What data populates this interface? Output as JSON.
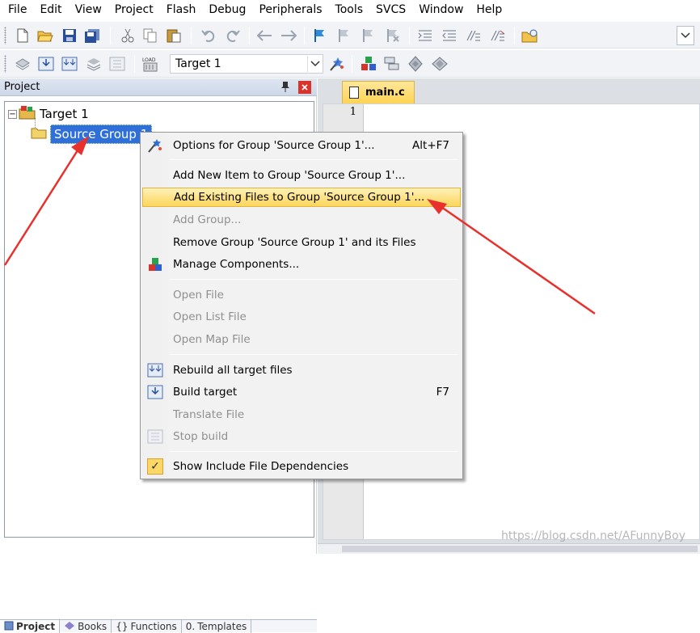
{
  "menubar": {
    "items": [
      "File",
      "Edit",
      "View",
      "Project",
      "Flash",
      "Debug",
      "Peripherals",
      "Tools",
      "SVCS",
      "Window",
      "Help"
    ]
  },
  "toolbar2": {
    "target_value": "Target 1"
  },
  "project_panel": {
    "title": "Project",
    "tree": {
      "target": "Target 1",
      "group": "Source Group 1"
    },
    "bottom_tabs": [
      "Project",
      "Books",
      "Functions",
      "Templates"
    ]
  },
  "editor": {
    "tab_label": "main.c",
    "line_numbers": [
      "1"
    ]
  },
  "context_menu": {
    "items": [
      {
        "label": "Options for Group 'Source Group 1'...",
        "shortcut": "Alt+F7"
      },
      {
        "label": "Add New  Item to Group 'Source Group 1'...",
        "shortcut": ""
      },
      {
        "label": "Add Existing Files to Group 'Source Group 1'...",
        "shortcut": ""
      },
      {
        "label": "Add Group...",
        "shortcut": ""
      },
      {
        "label": "Remove Group 'Source Group 1' and its Files",
        "shortcut": ""
      },
      {
        "label": "Manage Components...",
        "shortcut": ""
      },
      {
        "label": "Open File",
        "shortcut": ""
      },
      {
        "label": "Open List File",
        "shortcut": ""
      },
      {
        "label": "Open Map File",
        "shortcut": ""
      },
      {
        "label": "Rebuild all target files",
        "shortcut": ""
      },
      {
        "label": "Build target",
        "shortcut": "F7"
      },
      {
        "label": "Translate File",
        "shortcut": ""
      },
      {
        "label": "Stop build",
        "shortcut": ""
      },
      {
        "label": "Show Include File Dependencies",
        "shortcut": ""
      }
    ]
  },
  "watermark": "https://blog.csdn.net/AFunnyBoy",
  "colors": {
    "highlight": "#fbd65b",
    "selection": "#2f6fd8",
    "annotation_arrow": "#e8312c",
    "close_button": "#d9342b"
  }
}
